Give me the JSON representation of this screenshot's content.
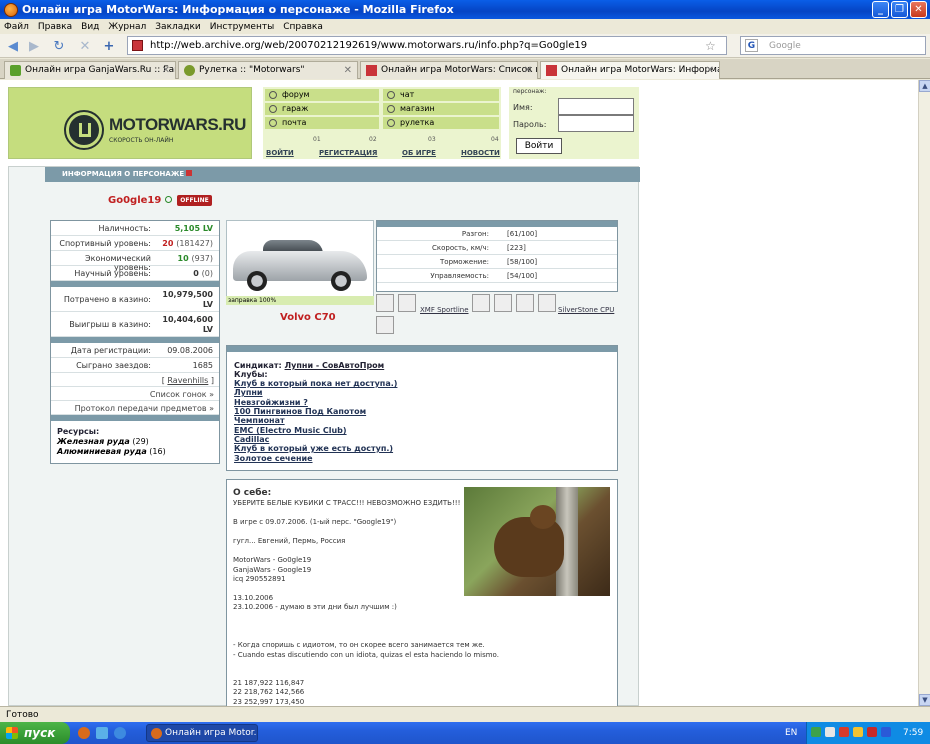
{
  "window": {
    "title": "Онлайн игра MotorWars: Информация о персонаже - Mozilla Firefox"
  },
  "menubar": [
    "Файл",
    "Правка",
    "Вид",
    "Журнал",
    "Закладки",
    "Инструменты",
    "Справка"
  ],
  "nav": {
    "url": "http://web.archive.org/web/20070212192619/www.motorwars.ru/info.php?q=Go0gle19",
    "search_placeholder": "Google"
  },
  "tabs": [
    {
      "label": "Онлайн игра GanjaWars.Ru :: Ган..."
    },
    {
      "label": "Рулетка :: \"Motorwars\""
    },
    {
      "label": "Онлайн игра MotorWars: Список гоно..."
    },
    {
      "label": "Онлайн игра MotorWars: Информаци..."
    }
  ],
  "header": {
    "logo_text": "MOTORWARS.RU",
    "logo_sub": "СКОРОСТЬ ОН-ЛАЙН",
    "menu": [
      [
        "форум",
        "чат"
      ],
      [
        "гараж",
        "магазин"
      ],
      [
        "почта",
        "рулетка"
      ]
    ],
    "nums": [
      "01",
      "02",
      "03",
      "04"
    ],
    "links": [
      "ВОЙТИ",
      "РЕГИСТРАЦИЯ",
      "ОБ ИГРЕ",
      "НОВОСТИ"
    ],
    "login": {
      "caption": "персонаж:",
      "name_label": "Имя:",
      "pass_label": "Пароль:",
      "button": "Войти"
    }
  },
  "section_title": "ИНФОРМАЦИЯ О ПЕРСОНАЖЕ",
  "player": {
    "name": "Go0gle19",
    "status": "OFFLINE"
  },
  "stats": [
    {
      "k": "Наличность:",
      "v": "5,105",
      "u": "LV"
    },
    {
      "k": "Спортивный уровень:",
      "v": "20",
      "n": "(181427)"
    },
    {
      "k": "Экономический уровень:",
      "v": "10",
      "n": "(937)"
    },
    {
      "k": "Научный уровень:",
      "v": "0",
      "n": "(0)"
    }
  ],
  "casino": [
    {
      "k": "Потрачено в казино:",
      "v": "10,979,500",
      "u": "LV"
    },
    {
      "k": "Выигрыш в казино:",
      "v": "10,404,600",
      "u": "LV"
    }
  ],
  "info": [
    {
      "k": "Дата регистрации:",
      "v": "09.08.2006"
    },
    {
      "k": "Сыграно заездов:",
      "v": "1685"
    }
  ],
  "links_list": [
    "Ravenhills",
    "Список гонок",
    "Протокол передачи предметов"
  ],
  "resources": {
    "title": "Ресурсы:",
    "items": [
      {
        "name": "Железная руда",
        "n": "(29)"
      },
      {
        "name": "Алюминиевая руда",
        "n": "(16)"
      }
    ]
  },
  "car": {
    "fuel_label": "заправка 100%",
    "name": "Volvo C70",
    "specs": [
      {
        "k": "Разгон:",
        "v": "[61/100]"
      },
      {
        "k": "Скорость, км/ч:",
        "v": "[223]"
      },
      {
        "k": "Торможение:",
        "v": "[58/100]"
      },
      {
        "k": "Управляемость:",
        "v": "[54/100]"
      }
    ],
    "parts": [
      "XMF Sportline",
      "SilverStone CPU"
    ]
  },
  "clubs": {
    "syndicate_label": "Синдикат:",
    "syndicate": "Лупни - СовАвтоПром",
    "clubs_label": "Клубы:",
    "items": [
      "Клуб в который пока нет доступа.)",
      "Лупни",
      "Невзгойжизни ?",
      "100 Пингвинов Под Капотом",
      "Чемпионат",
      "EMC (Electro Music Club)",
      "Cadillac",
      "Клуб в который уже есть доступ.)",
      "Золотое сечение"
    ]
  },
  "about": {
    "title": "О себе:",
    "lines": [
      "УБЕРИТЕ БЕЛЫЕ КУБИКИ С ТРАСС!!! НЕВОЗМОЖНО ЕЗДИТЬ!!!",
      "В игре с 09.07.2006. (1-ый перс. \"Google19\")",
      "гугл... Евгений, Пермь, Россия",
      "MotorWars - Go0gle19",
      "GanjaWars - Google19",
      "icq 290552891",
      "13.10.2006",
      "23.10.2006 - думаю в эти дни был лучшим :)",
      "- Когда споришь с идиотом, то он скорее всего занимается тем же.",
      "- Cuando estas discutiendo con un idiota, quizas el esta haciendo lo mismo.",
      "21 187,922 116,847",
      "22 218,762 142,566",
      "23 252,997 173,450"
    ]
  },
  "statusbar": "Готово",
  "taskbar": {
    "start": "пуск",
    "task": "Онлайн игра Motor...",
    "lang": "EN",
    "time": "7:59"
  }
}
